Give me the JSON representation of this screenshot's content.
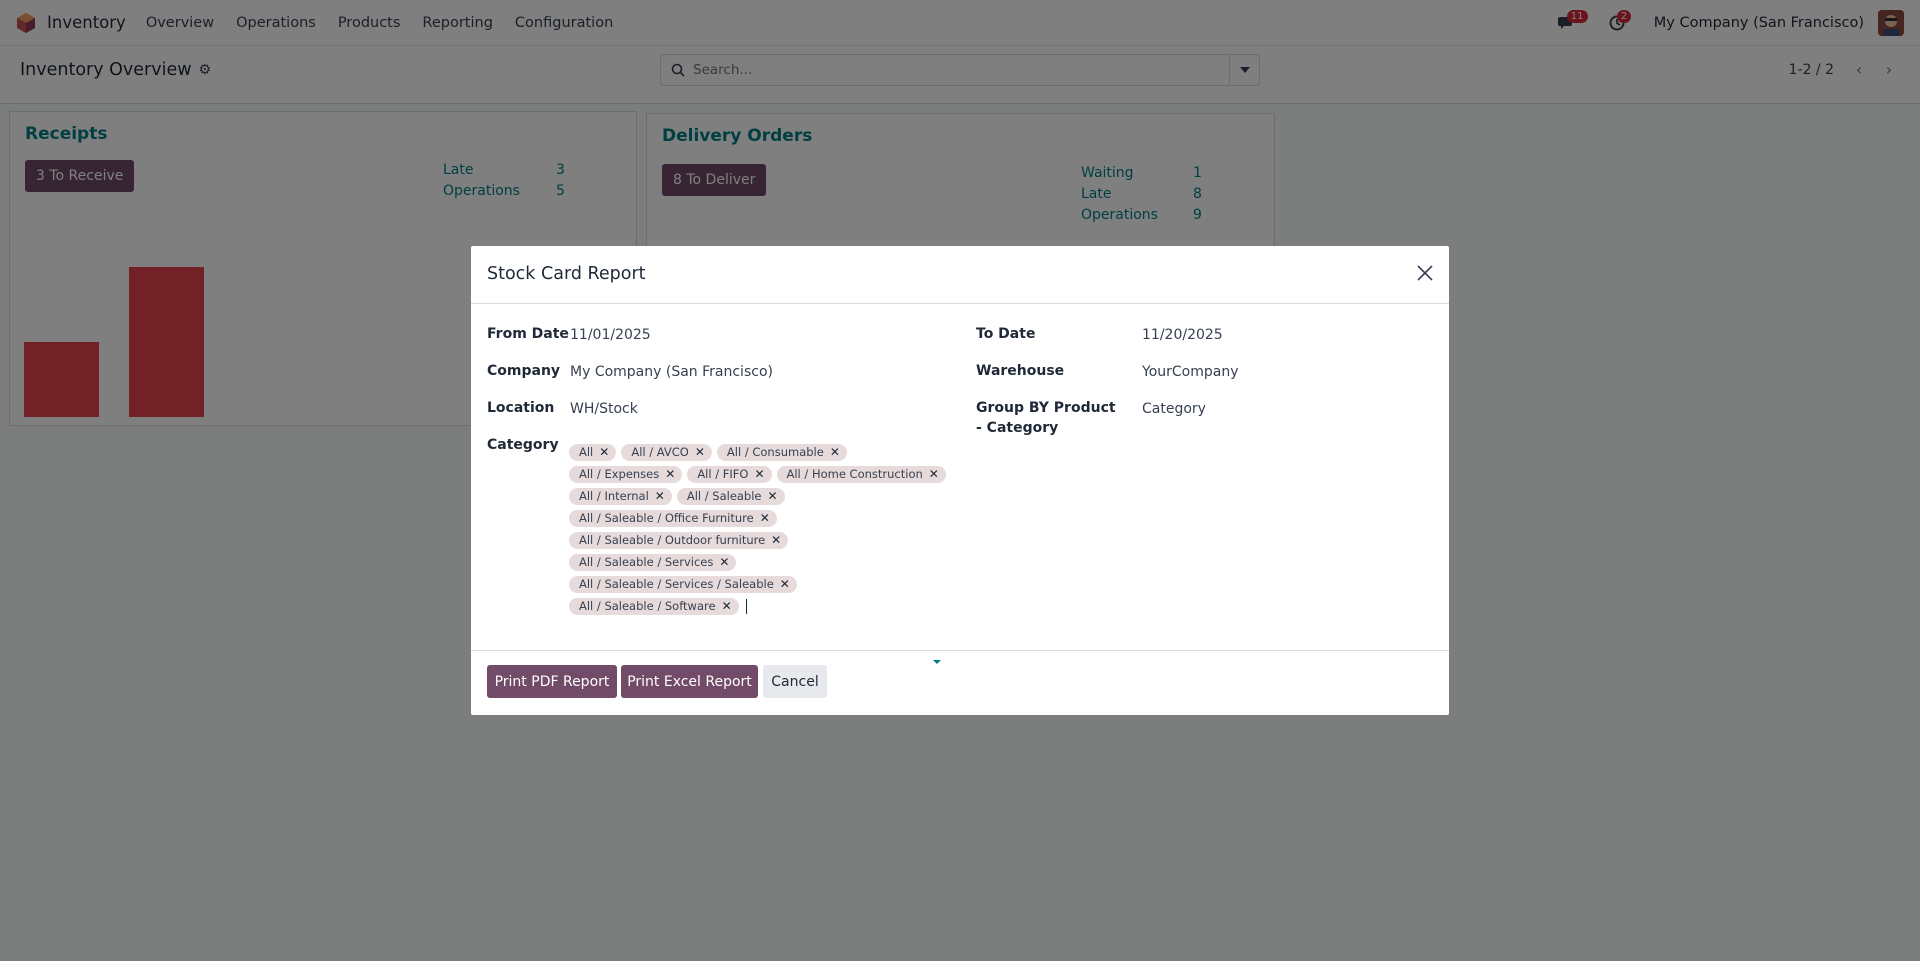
{
  "navbar": {
    "app_name": "Inventory",
    "menu": [
      "Overview",
      "Operations",
      "Products",
      "Reporting",
      "Configuration"
    ],
    "messages_badge": "11",
    "activities_badge": "2",
    "company": "My Company (San Francisco)"
  },
  "control_panel": {
    "title": "Inventory Overview",
    "search_placeholder": "Search...",
    "pager": "1-2 / 2"
  },
  "cards": {
    "receipts": {
      "title": "Receipts",
      "button": "3 To Receive",
      "stats": [
        {
          "label": "Late",
          "value": "3"
        },
        {
          "label": "Operations",
          "value": "5"
        }
      ],
      "bars": [
        0.5,
        1.0
      ]
    },
    "delivery": {
      "title": "Delivery Orders",
      "button": "8 To Deliver",
      "stats": [
        {
          "label": "Waiting",
          "value": "1"
        },
        {
          "label": "Late",
          "value": "8"
        },
        {
          "label": "Operations",
          "value": "9"
        }
      ]
    }
  },
  "modal": {
    "title": "Stock Card Report",
    "fields": {
      "from_date_label": "From Date",
      "from_date": "11/01/2025",
      "to_date_label": "To Date",
      "to_date": "11/20/2025",
      "company_label": "Company",
      "company": "My Company (San Francisco)",
      "warehouse_label": "Warehouse",
      "warehouse": "YourCompany",
      "location_label": "Location",
      "location": "WH/Stock",
      "group_by_label": "Group BY Product - Category",
      "group_by": "Category",
      "category_label": "Category"
    },
    "category_tags": [
      [
        "All",
        "All / AVCO",
        "All / Consumable"
      ],
      [
        "All / Expenses",
        "All / FIFO",
        "All / Home Construction"
      ],
      [
        "All / Internal",
        "All / Saleable"
      ],
      [
        "All / Saleable / Office Furniture"
      ],
      [
        "All / Saleable / Outdoor furniture"
      ],
      [
        "All / Saleable / Services"
      ],
      [
        "All / Saleable / Services / Saleable"
      ],
      [
        "All / Saleable / Software"
      ]
    ],
    "buttons": {
      "print_pdf": "Print PDF Report",
      "print_excel": "Print Excel Report",
      "cancel": "Cancel"
    }
  }
}
